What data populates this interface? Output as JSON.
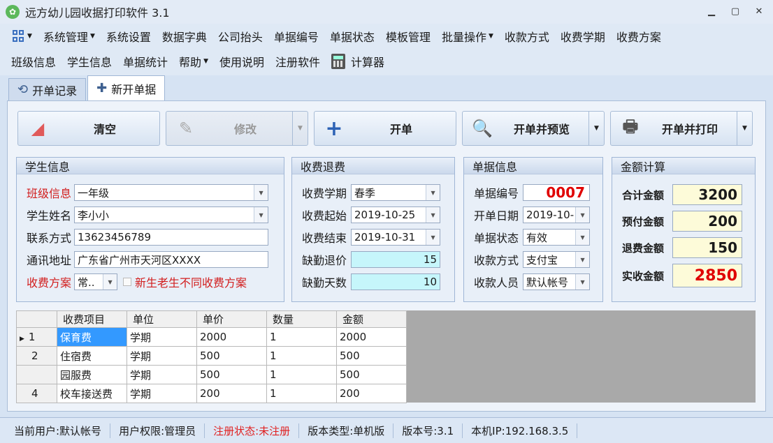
{
  "window": {
    "title": "远方幼儿园收据打印软件 3.1"
  },
  "menu": {
    "row1": [
      {
        "label": "系统管理",
        "dropdown": true
      },
      {
        "label": "系统设置",
        "dropdown": false
      },
      {
        "label": "数据字典",
        "dropdown": false
      },
      {
        "label": "公司抬头",
        "dropdown": false
      },
      {
        "label": "单据编号",
        "dropdown": false
      },
      {
        "label": "单据状态",
        "dropdown": false
      },
      {
        "label": "模板管理",
        "dropdown": false
      },
      {
        "label": "批量操作",
        "dropdown": true
      },
      {
        "label": "收款方式",
        "dropdown": false
      },
      {
        "label": "收费学期",
        "dropdown": false
      },
      {
        "label": "收费方案",
        "dropdown": false
      }
    ],
    "row2": [
      {
        "label": "班级信息",
        "dropdown": false
      },
      {
        "label": "学生信息",
        "dropdown": false
      },
      {
        "label": "单据统计",
        "dropdown": false
      },
      {
        "label": "帮助",
        "dropdown": true
      },
      {
        "label": "使用说明",
        "dropdown": false
      },
      {
        "label": "注册软件",
        "dropdown": false
      },
      {
        "label": "计算器",
        "dropdown": false
      }
    ]
  },
  "tabs": [
    {
      "label": "开单记录",
      "icon": "history-icon"
    },
    {
      "label": "新开单据",
      "icon": "plus-icon"
    }
  ],
  "toolbar": {
    "clear": "清空",
    "edit": "修改",
    "create": "开单",
    "create_preview": "开单并预览",
    "create_print": "开单并打印"
  },
  "student": {
    "title": "学生信息",
    "class_label": "班级信息",
    "class_value": "一年级",
    "name_label": "学生姓名",
    "name_value": "李小小",
    "contact_label": "联系方式",
    "contact_value": "13623456789",
    "address_label": "通讯地址",
    "address_value": "广东省广州市天河区XXXX",
    "plan_label": "收费方案",
    "plan_value": "常..",
    "plan_checkbox": "新生老生不同收费方案"
  },
  "refund": {
    "title": "收费退费",
    "term_label": "收费学期",
    "term_value": "春季",
    "start_label": "收费起始",
    "start_value": "2019-10-25",
    "end_label": "收费结束",
    "end_value": "2019-10-31",
    "absence_price_label": "缺勤退价",
    "absence_price_value": "15",
    "absence_days_label": "缺勤天数",
    "absence_days_value": "10"
  },
  "receipt": {
    "title": "单据信息",
    "no_label": "单据编号",
    "no_value": "0007",
    "date_label": "开单日期",
    "date_value": "2019-10-",
    "status_label": "单据状态",
    "status_value": "有效",
    "method_label": "收款方式",
    "method_value": "支付宝",
    "staff_label": "收款人员",
    "staff_value": "默认帐号"
  },
  "amount": {
    "title": "金额计算",
    "total_label": "合计金额",
    "total_value": "3200",
    "prepaid_label": "预付金额",
    "prepaid_value": "200",
    "refund_label": "退费金额",
    "refund_value": "150",
    "actual_label": "实收金额",
    "actual_value": "2850"
  },
  "grid": {
    "columns": [
      "收费项目",
      "单位",
      "单价",
      "数量",
      "金额"
    ],
    "rows": [
      {
        "no": "1",
        "item": "保育费",
        "unit": "学期",
        "price": "2000",
        "qty": "1",
        "amount": "2000"
      },
      {
        "no": "2",
        "item": "住宿费",
        "unit": "学期",
        "price": "500",
        "qty": "1",
        "amount": "500"
      },
      {
        "no": "",
        "item": "园服费",
        "unit": "学期",
        "price": "500",
        "qty": "1",
        "amount": "500"
      },
      {
        "no": "4",
        "item": "校车接送费",
        "unit": "学期",
        "price": "200",
        "qty": "1",
        "amount": "200"
      }
    ]
  },
  "status": {
    "user": "当前用户:默认帐号",
    "role": "用户权限:管理员",
    "reg": "注册状态:未注册",
    "edition": "版本类型:单机版",
    "version": "版本号:3.1",
    "ip": "本机IP:192.168.3.5"
  }
}
